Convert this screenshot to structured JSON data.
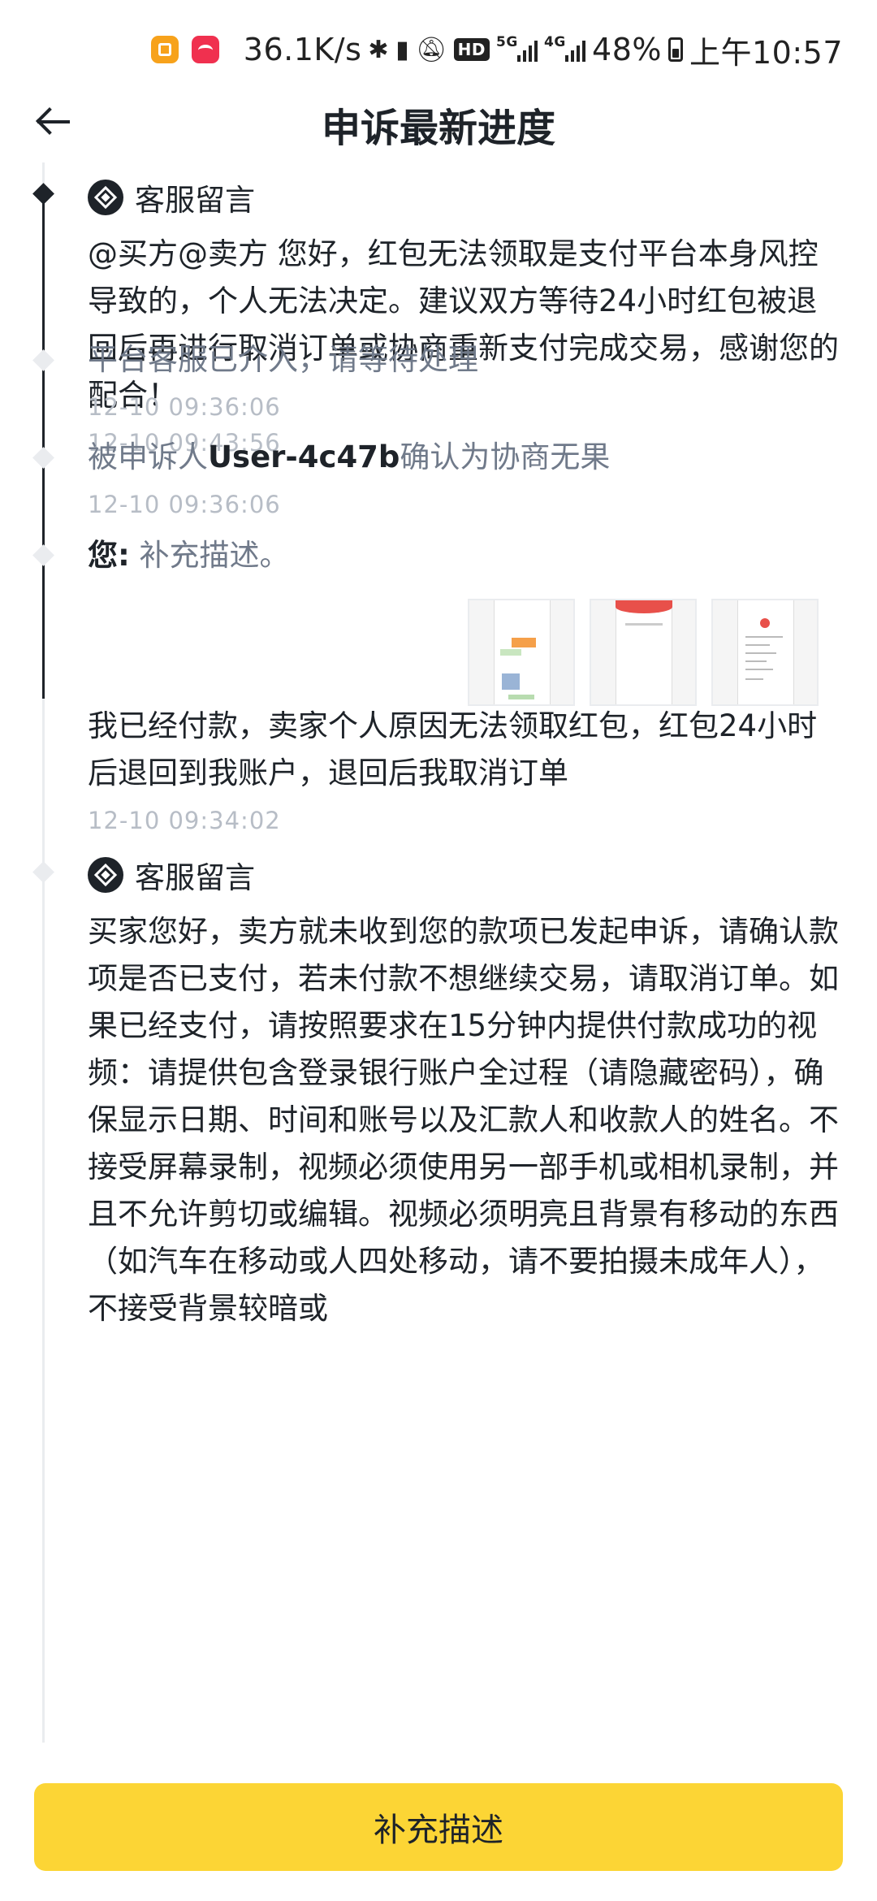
{
  "status_bar": {
    "net_speed": "36.1K/s",
    "hd_label": "HD",
    "sim1_label": "5G",
    "sim2_label": "4G",
    "battery": "48%",
    "time": "上午10:57"
  },
  "header": {
    "title": "申诉最新进度"
  },
  "timeline": [
    {
      "type": "agent",
      "author": "客服留言",
      "text": "@买方@卖方 您好，红包无法领取是支付平台本身风控导致的，个人无法决定。建议双方等待24小时红包被退回后再进行取消订单或协商重新支付完成交易，感谢您的配合！",
      "time": "12-10 09:43:56"
    },
    {
      "type": "system",
      "text": "平台客服已介入，请等待处理",
      "time": "12-10 09:36:06"
    },
    {
      "type": "system",
      "text_prefix": "被申诉人",
      "user": "User-4c47b",
      "text_suffix": "确认为协商无果",
      "time": "12-10 09:36:06"
    },
    {
      "type": "user",
      "label": "您:",
      "text": " 补充描述。",
      "attachments": 3,
      "message": "我已经付款，卖家个人原因无法领取红包，红包24小时后退回到我账户，退回后我取消订单",
      "time": "12-10 09:34:02"
    },
    {
      "type": "agent",
      "author": "客服留言",
      "text": "买家您好，卖方就未收到您的款项已发起申诉，请确认款项是否已支付，若未付款不想继续交易，请取消订单。如果已经支付，请按照要求在15分钟内提供付款成功的视频：请提供包含登录银行账户全过程（请隐藏密码），确保显示日期、时间和账号以及汇款人和收款人的姓名。不接受屏幕录制，视频必须使用另一部手机或相机录制，并且不允许剪切或编辑。视频必须明亮且背景有移动的东西（如汽车在移动或人四处移动，请不要拍摄未成年人），不接受背景较暗或"
    }
  ],
  "bottom": {
    "button_label": "补充描述"
  },
  "colors": {
    "accent": "#fcd535",
    "text_primary": "#1e2329",
    "text_secondary": "#707a8a",
    "text_time": "#b7bdc6",
    "timeline_gray": "#eaecef"
  }
}
